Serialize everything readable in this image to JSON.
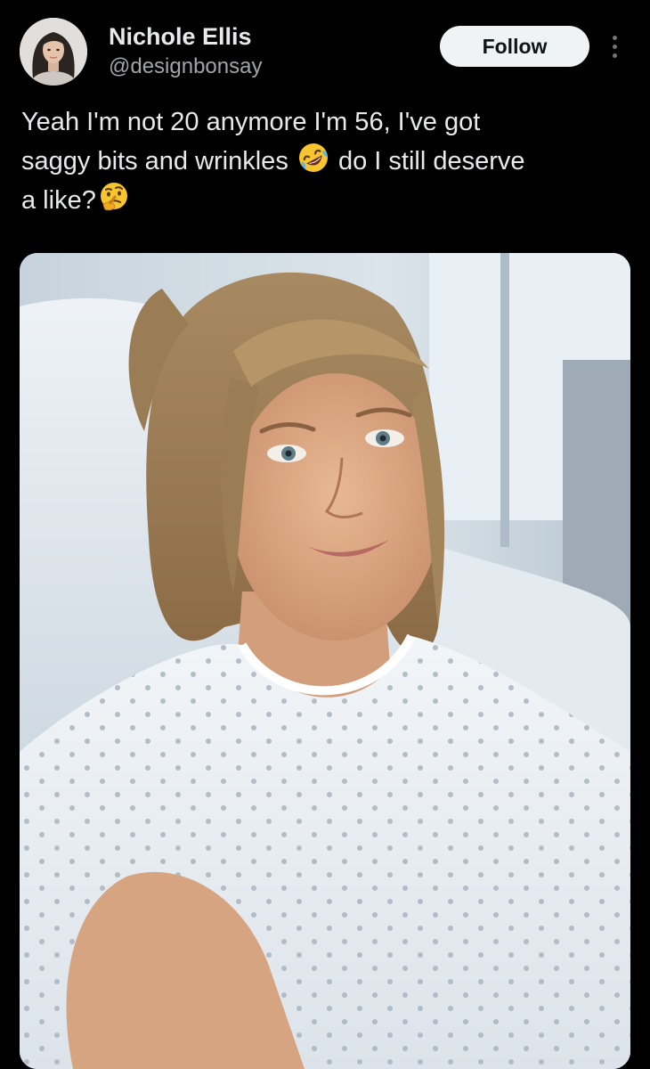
{
  "author": {
    "display_name": "Nichole Ellis",
    "handle": "@designbonsay",
    "avatar_icon": "profile-photo"
  },
  "actions": {
    "follow_label": "Follow",
    "more_icon": "more-vertical-icon"
  },
  "post": {
    "line1": "Yeah I'm not 20 anymore I'm 56, I've got",
    "line2_before": "saggy bits and wrinkles",
    "emoji1": "rolling-on-floor-laughing-emoji",
    "line2_after": "do I still deserve",
    "line3": "a like?",
    "emoji2": "thinking-face-emoji"
  },
  "media": {
    "type": "photo"
  },
  "theme": {
    "background": "#000000",
    "text": "#e7e9ea",
    "secondary_text": "#a0a5aa",
    "follow_bg": "#eff3f4"
  }
}
